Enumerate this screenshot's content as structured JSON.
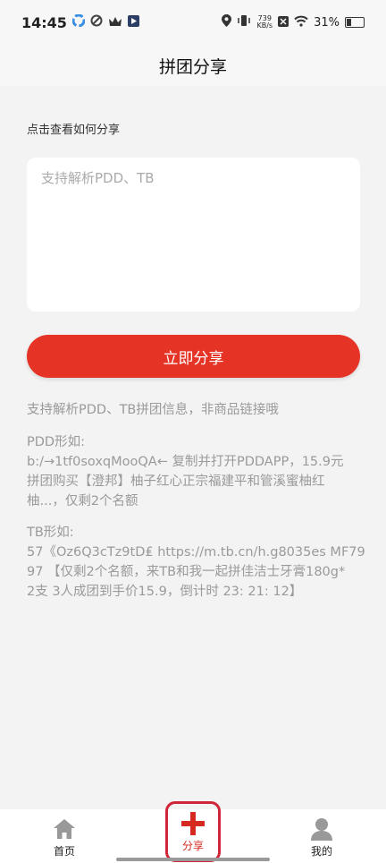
{
  "status": {
    "time": "14:45",
    "speed_value": "739",
    "speed_unit": "KB/s",
    "battery": "31%"
  },
  "nav": {
    "title": "拼团分享"
  },
  "hint": "点击查看如何分享",
  "input": {
    "placeholder": "支持解析PDD、TB",
    "value": ""
  },
  "share_button": "立即分享",
  "info": {
    "line1": "支持解析PDD、TB拼团信息，非商品链接哦",
    "pdd_title": "PDD形如:",
    "pdd_lines": [
      "b:/→1tf0soxqMooQA← 复制并打开PDDAPP，15.9元",
      "拼团购买【澄邦】柚子红心正宗福建平和管溪蜜柚红",
      "柚...，仅剩2个名额"
    ],
    "tb_title": "TB形如:",
    "tb_lines": [
      "57《Oz6Q3cTz9tD₤ https://m.tb.cn/h.g8035es MF79",
      "97 【仅剩2个名额，来TB和我一起拼佳洁士牙膏180g*",
      "2支 3人成团到手价15.9，倒计时 23: 21: 12】"
    ]
  },
  "tabs": [
    {
      "label": "首页",
      "icon": "home-icon"
    },
    {
      "label": "分享",
      "icon": "plus-icon"
    },
    {
      "label": "我的",
      "icon": "user-icon"
    }
  ],
  "colors": {
    "accent": "#e53326",
    "text_muted": "#9a9a9a",
    "background": "#f3f3f3"
  }
}
